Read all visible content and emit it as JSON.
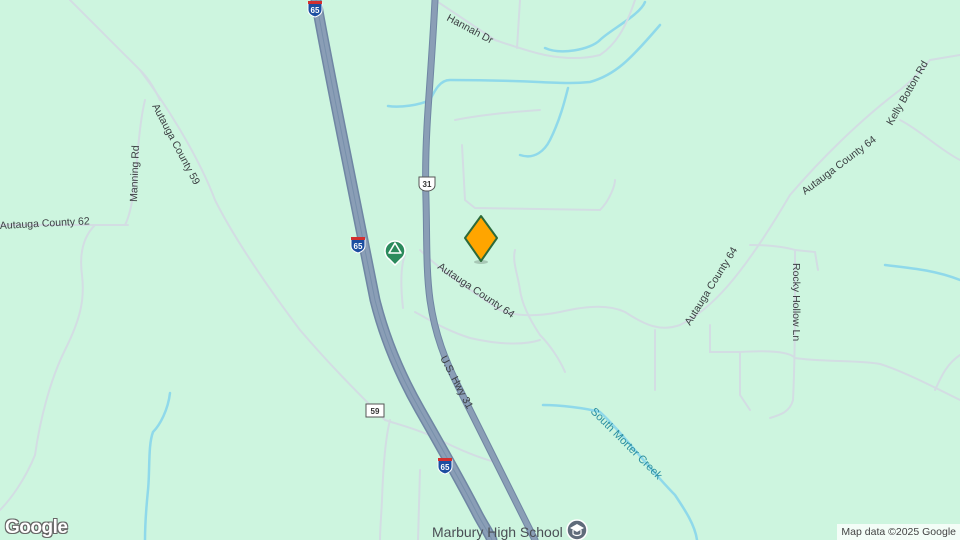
{
  "map": {
    "attribution": "Map data ©2025 Google",
    "logo": "Google",
    "marker": {
      "icon": "diamond-pin-icon",
      "color": "#FFA500"
    },
    "poi": {
      "icon": "campground-icon",
      "color": "#2b8a5c"
    },
    "school": {
      "label": "Marbury High School",
      "icon": "school-icon"
    },
    "roads": {
      "hannah": "Hannah Dr",
      "autauga59": "Autauga County 59",
      "manning": "Manning Rd",
      "autauga62": "Autauga County 62",
      "autauga64_w": "Autauga County 64",
      "autauga64_e": "Autauga County 64",
      "autauga64_ne": "Autauga County 64",
      "kelly": "Kelly Botton Rd",
      "rocky": "Rocky Hollow Ln",
      "ushwy31": "U.S. Hwy 31"
    },
    "water": {
      "creek": "South Morter Creek"
    },
    "shields": {
      "i65": "65",
      "us31": "31",
      "r59": "59"
    },
    "colors": {
      "land": "#cdf5df",
      "highway": "#8a9eb6",
      "road": "#d3dde3",
      "water": "#8fd9ea"
    }
  }
}
